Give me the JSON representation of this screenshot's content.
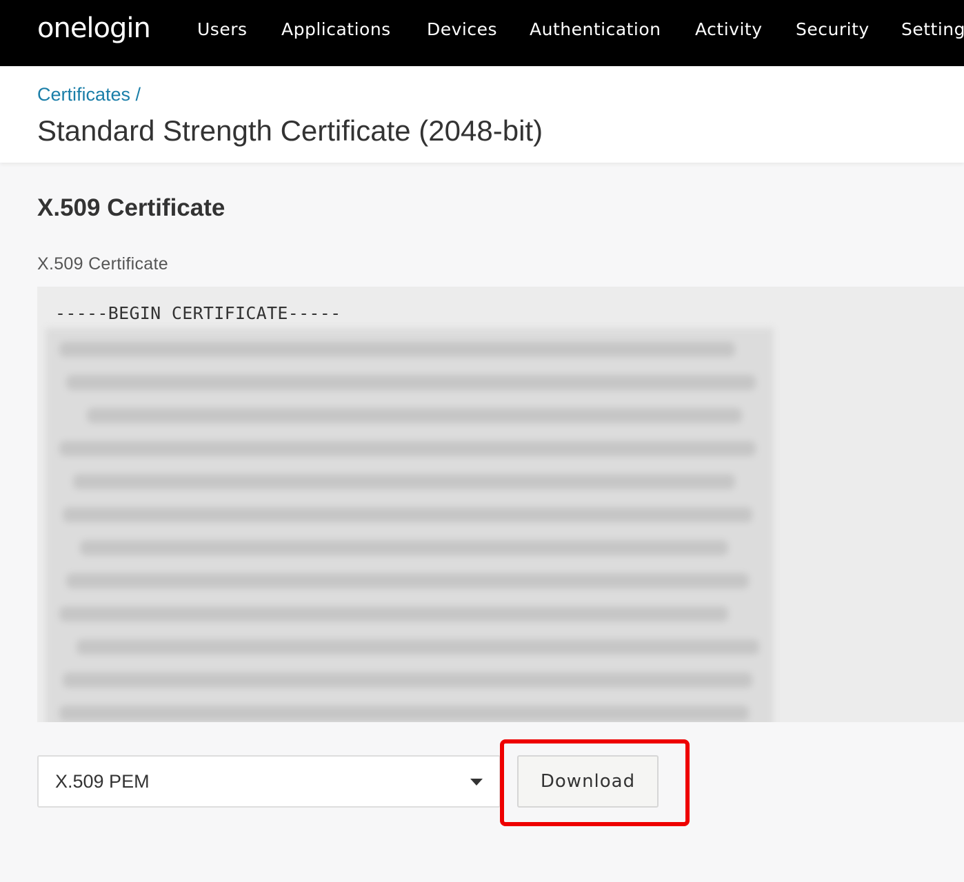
{
  "app": {
    "logo": "onelogin"
  },
  "nav": {
    "items": [
      {
        "label": "Users"
      },
      {
        "label": "Applications"
      },
      {
        "label": "Devices"
      },
      {
        "label": "Authentication"
      },
      {
        "label": "Activity"
      },
      {
        "label": "Security"
      },
      {
        "label": "Setting"
      }
    ]
  },
  "header": {
    "breadcrumb": "Certificates /",
    "title": "Standard Strength Certificate (2048-bit)"
  },
  "section": {
    "title": "X.509 Certificate",
    "field_label": "X.509 Certificate",
    "cert_begin": "-----BEGIN CERTIFICATE-----"
  },
  "format_select": {
    "value": "X.509 PEM"
  },
  "download_button": {
    "label": "Download"
  },
  "colors": {
    "nav_bg": "#000000",
    "link": "#1a7ea8",
    "highlight": "#ee0000"
  }
}
